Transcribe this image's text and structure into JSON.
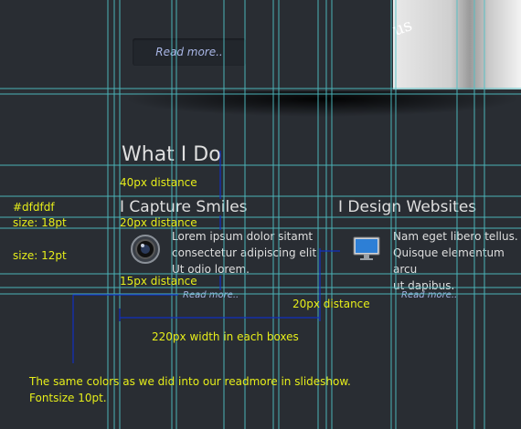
{
  "slideshow": {
    "read_more": "Read more..",
    "image_text": "us"
  },
  "section": {
    "title": "What I Do",
    "boxes": [
      {
        "heading": "I Capture Smiles",
        "text": [
          "Lorem ipsum dolor sitamt",
          "consectetur adipiscing elit",
          "Ut odio lorem."
        ],
        "link": "Read more..",
        "icon": "camera-lens-icon"
      },
      {
        "heading": "I Design Websites",
        "text": [
          "Nam eget libero tellus.",
          "Quisque elementum arcu",
          "ut dapibus."
        ],
        "link": "Read more..",
        "icon": "monitor-icon"
      }
    ]
  },
  "annotations": {
    "color": "#dfdfdf",
    "heading_size": "size: 18pt",
    "text_size": "size: 12pt",
    "d40": "40px distance",
    "d20a": "20px distance",
    "d15": "15px distance",
    "d20b": "20px distance",
    "width": "220px width in each boxes",
    "note1": "The same colors as we did into our readmore in slideshow.",
    "note2": "Fontsize 10pt."
  },
  "colors": {
    "background": "#292d33",
    "text": "#dfdfdf",
    "link": "#a9b6e6",
    "annotation": "#e6ee1a",
    "guide": "#4fc1c6",
    "measure": "#1030c0"
  }
}
